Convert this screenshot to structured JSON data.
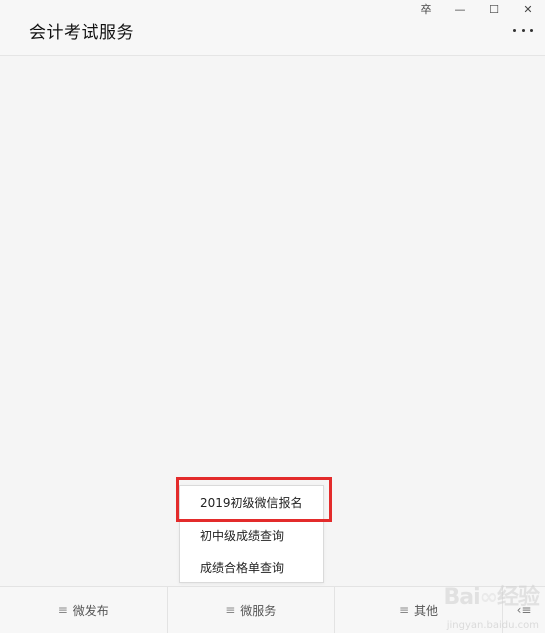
{
  "window": {
    "title": "会计考试服务",
    "controls": {
      "pin": "卒",
      "minimize": "—",
      "maximize": "☐",
      "close": "✕"
    }
  },
  "popup_menu": {
    "items": [
      {
        "label": "2019初级微信报名",
        "highlighted": true
      },
      {
        "label": "初中级成绩查询"
      },
      {
        "label": "成绩合格单查询"
      }
    ]
  },
  "bottom_tabs": [
    {
      "label": "微发布",
      "icon": "menu-icon"
    },
    {
      "label": "微服务",
      "icon": "menu-icon"
    },
    {
      "label": "其他",
      "icon": "menu-icon"
    }
  ],
  "keyboard_toggle_icon": "keyboard-toggle-icon",
  "colors": {
    "highlight_border": "#e32b2b",
    "background": "#f5f5f5"
  }
}
